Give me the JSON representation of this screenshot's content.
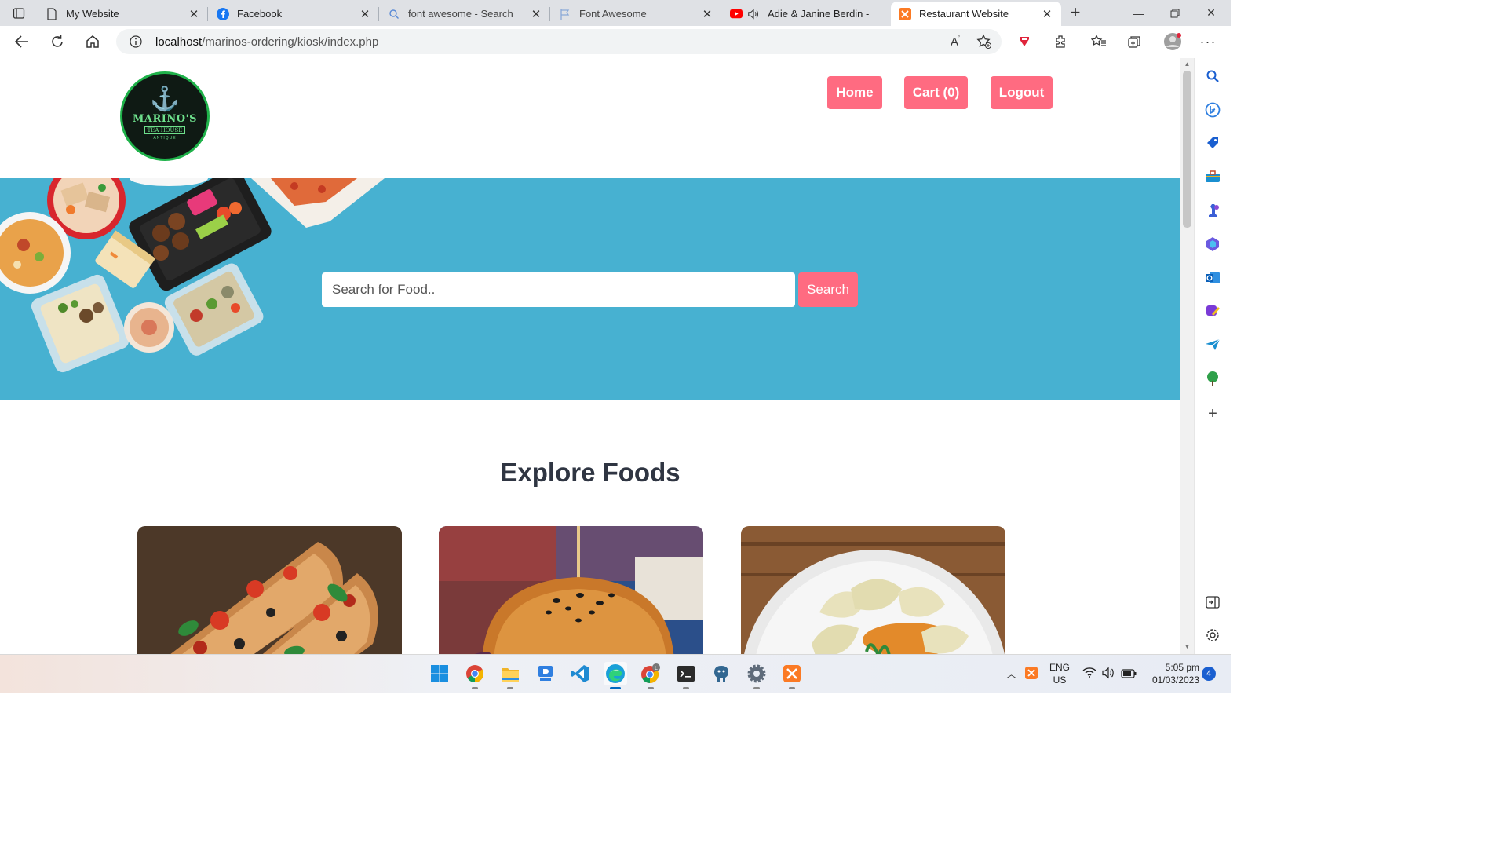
{
  "browser": {
    "tabs": [
      {
        "title": "My Website",
        "icon": "page-icon",
        "active": false
      },
      {
        "title": "Facebook",
        "icon": "facebook-icon",
        "active": false
      },
      {
        "title": "font awesome - Search",
        "icon": "search-icon",
        "active": false
      },
      {
        "title": "Font Awesome",
        "icon": "flag-icon",
        "active": false
      },
      {
        "title": "Adie & Janine Berdin -",
        "icon": "youtube-icon",
        "active": false
      },
      {
        "title": "Restaurant Website",
        "icon": "xampp-icon",
        "active": true
      }
    ],
    "url_host": "localhost",
    "url_path": "/marinos-ordering/kiosk/index.php"
  },
  "site": {
    "logo": {
      "brand": "MARINO'S",
      "sub": "TEA HOUSE",
      "sub2": "ANTIQUE"
    },
    "nav": {
      "home": "Home",
      "cart": "Cart (0)",
      "logout": "Logout"
    },
    "search": {
      "placeholder": "Search for Food..",
      "button": "Search"
    },
    "explore_title": "Explore Foods",
    "cards": [
      {
        "name": "pizza"
      },
      {
        "name": "burger"
      },
      {
        "name": "momo"
      }
    ]
  },
  "taskbar": {
    "lang": "ENG",
    "region": "US",
    "time": "5:05 pm",
    "date": "01/03/2023",
    "notifications": "4"
  },
  "colors": {
    "accent": "#ff6b81",
    "hero": "#47b1d1",
    "title": "#2f3542"
  }
}
